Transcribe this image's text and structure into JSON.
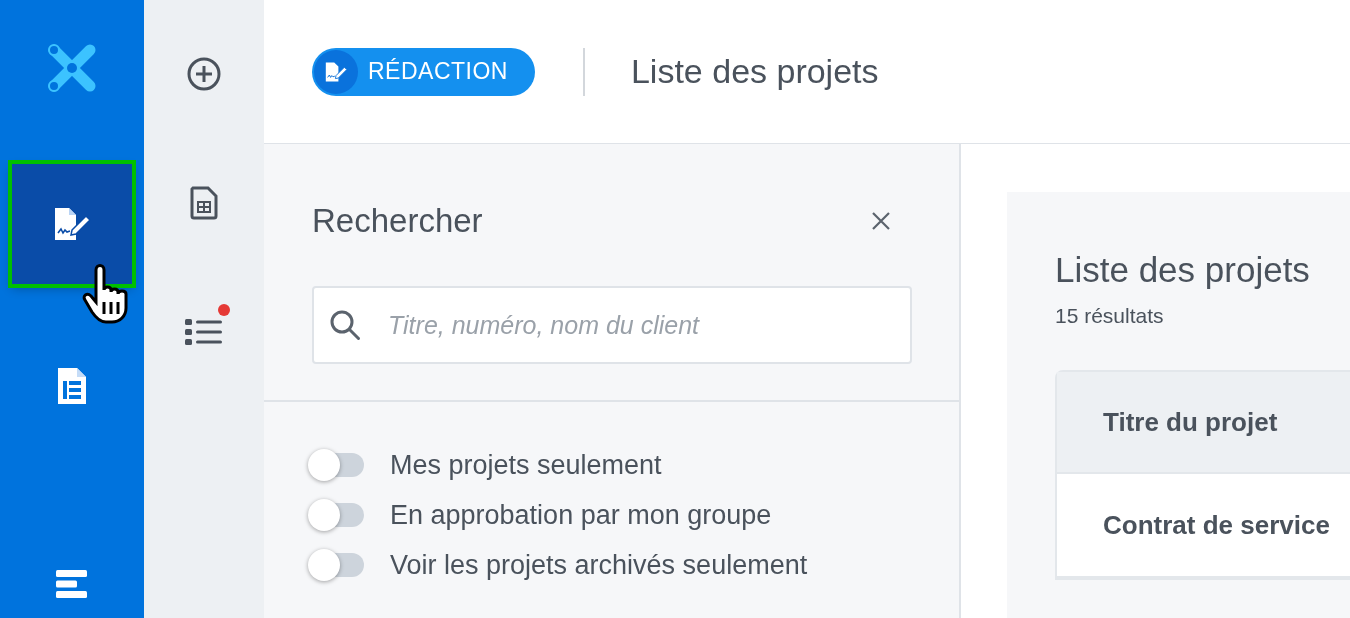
{
  "rail": {
    "items": [
      {
        "kind": "sign",
        "selected": true
      },
      {
        "kind": "document",
        "selected": false
      },
      {
        "kind": "bars",
        "selected": false
      }
    ]
  },
  "tools": {
    "items": [
      {
        "kind": "add"
      },
      {
        "kind": "sheet"
      },
      {
        "kind": "list",
        "notification": true
      }
    ]
  },
  "header": {
    "module": "RÉDACTION",
    "title": "Liste des projets"
  },
  "search_panel": {
    "title": "Rechercher",
    "search": {
      "placeholder": "Titre, numéro, nom du client"
    },
    "toggles": [
      {
        "label": "Mes projets seulement",
        "on": false
      },
      {
        "label": "En approbation par mon groupe",
        "on": false
      },
      {
        "label": "Voir les projets archivés seulement",
        "on": false
      }
    ]
  },
  "content": {
    "title": "Liste des projets",
    "count": "15 résultats",
    "table": {
      "columns": [
        "Titre du projet"
      ],
      "rows": [
        [
          "Contrat de service"
        ]
      ]
    }
  }
}
